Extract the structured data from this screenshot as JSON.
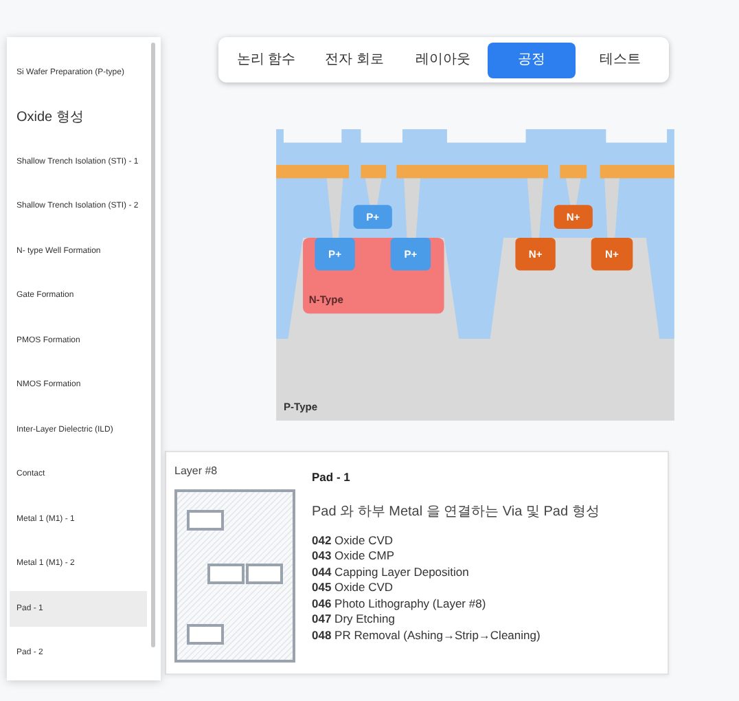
{
  "sidebar": {
    "items": [
      {
        "label": "Si Wafer Preparation (P-type)",
        "selected": false
      },
      {
        "label": "Oxide 형성",
        "selected": false
      },
      {
        "label": "Shallow Trench Isolation (STI) - 1",
        "selected": false
      },
      {
        "label": "Shallow Trench Isolation (STI) - 2",
        "selected": false
      },
      {
        "label": "N- type Well Formation",
        "selected": false
      },
      {
        "label": "Gate Formation",
        "selected": false
      },
      {
        "label": "PMOS Formation",
        "selected": false
      },
      {
        "label": "NMOS Formation",
        "selected": false
      },
      {
        "label": "Inter-Layer Dielectric (ILD)",
        "selected": false
      },
      {
        "label": "Contact",
        "selected": false
      },
      {
        "label": "Metal 1 (M1) - 1",
        "selected": false
      },
      {
        "label": "Metal 1 (M1) - 2",
        "selected": false
      },
      {
        "label": "Pad - 1",
        "selected": true
      },
      {
        "label": "Pad - 2",
        "selected": false
      }
    ]
  },
  "tabs": [
    {
      "label": "논리 함수",
      "selected": false
    },
    {
      "label": "전자 회로",
      "selected": false
    },
    {
      "label": "레이아웃",
      "selected": false
    },
    {
      "label": "공정",
      "selected": true
    },
    {
      "label": "테스트",
      "selected": false
    }
  ],
  "cross_section": {
    "p_plus": [
      "P+",
      "P+",
      "P+"
    ],
    "n_plus": [
      "N+",
      "N+",
      "N+"
    ],
    "well_label": "N-Type",
    "substrate_label": "P-Type"
  },
  "detail": {
    "layer_label": "Layer #8",
    "title": "Pad - 1",
    "description": "Pad 와 하부 Metal 을 연결하는 Via 및 Pad 형성",
    "steps": [
      "**042** Oxide CVD",
      "**043** Oxide CMP",
      "**044** Capping Layer Deposition",
      "**045** Oxide CVD",
      "**046** Photo Lithography (Layer #8)",
      "**047** Dry Etching",
      "**048** PR Removal (Ashing→Strip→Cleaning)"
    ]
  }
}
